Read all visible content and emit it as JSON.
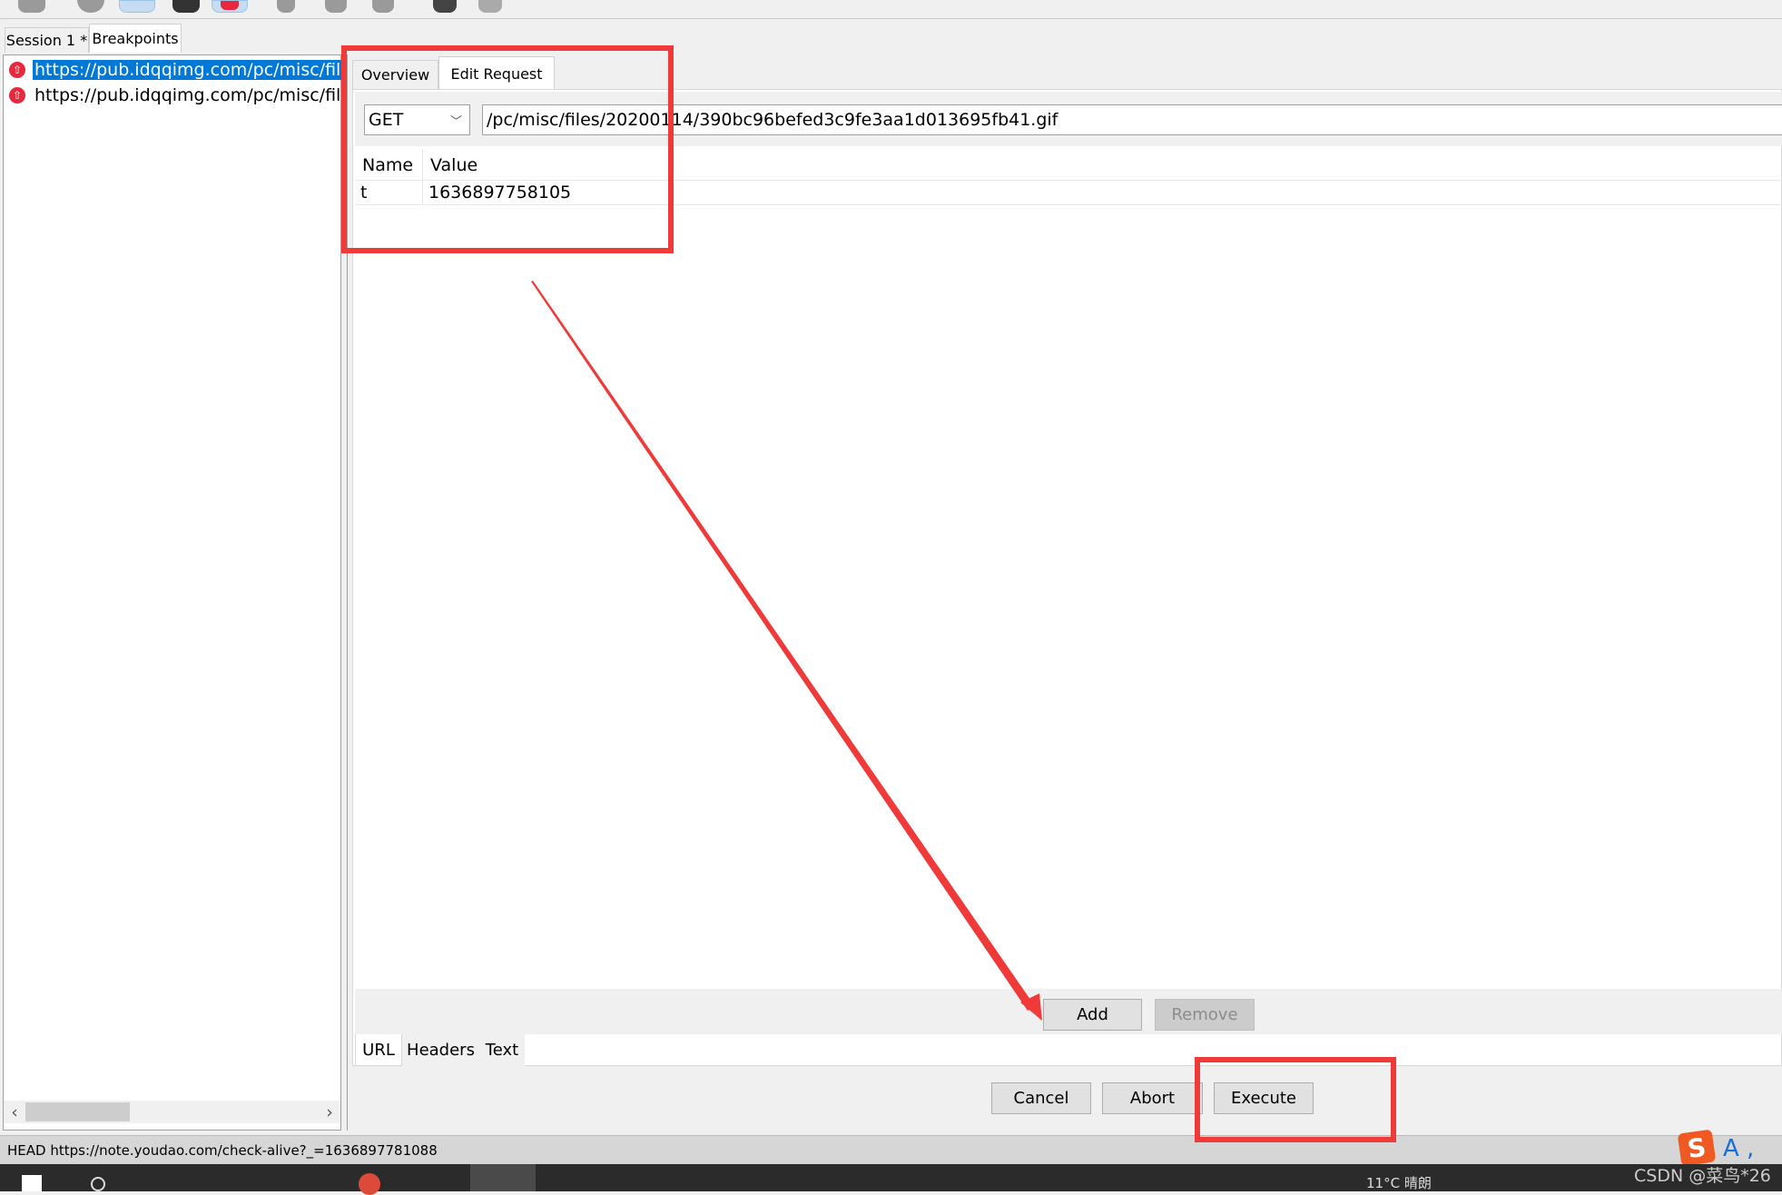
{
  "toolbar": {
    "icons": [
      "comment-icon",
      "replay-icon",
      "stream-icon",
      "decode-icon",
      "breakpoint-icon",
      "edit-icon",
      "undo-icon",
      "check-icon",
      "tools-icon",
      "settings-icon"
    ]
  },
  "session_tabs": [
    {
      "label": "Session 1 *"
    },
    {
      "label": "Breakpoints",
      "active": true
    }
  ],
  "breakpoints": [
    {
      "url": "https://pub.idqqimg.com/pc/misc/files",
      "selected": true
    },
    {
      "url": "https://pub.idqqimg.com/pc/misc/files",
      "selected": false
    }
  ],
  "detail_tabs": [
    {
      "label": "Overview"
    },
    {
      "label": "Edit Request",
      "active": true
    }
  ],
  "request": {
    "method": "GET",
    "path": "/pc/misc/files/20200114/390bc96befed3c9fe3aa1d013695fb41.gif"
  },
  "params": {
    "headers": [
      "Name",
      "Value"
    ],
    "rows": [
      {
        "name": "t",
        "value": "1636897758105"
      }
    ]
  },
  "param_buttons": {
    "add": "Add",
    "remove": "Remove"
  },
  "bottom_tabs": [
    {
      "label": "URL",
      "active": true
    },
    {
      "label": "Headers"
    },
    {
      "label": "Text"
    }
  ],
  "actions": {
    "cancel": "Cancel",
    "abort": "Abort",
    "execute": "Execute"
  },
  "status": "HEAD https://note.youdao.com/check-alive?_=1636897781088",
  "watermark": "CSDN @菜鸟*26",
  "taskbar": {
    "weather": "11°C 晴朗"
  },
  "colors": {
    "selection": "#0078d7",
    "annotation": "#f03a3a",
    "breakpoint": "#e8283c"
  }
}
